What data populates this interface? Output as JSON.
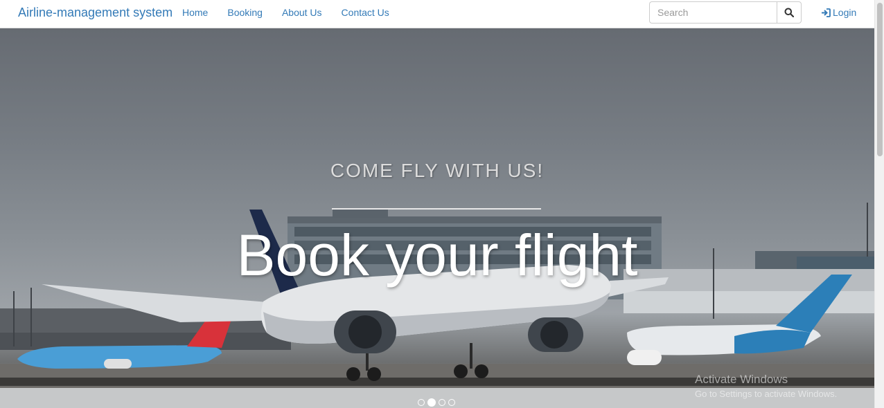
{
  "navbar": {
    "brand": "Airline-management system",
    "links": [
      "Home",
      "Booking",
      "About Us",
      "Contact Us"
    ],
    "search": {
      "placeholder": "Search",
      "value": ""
    },
    "login_label": "Login"
  },
  "hero": {
    "tagline": "COME FLY WITH US!",
    "headline": "Book your flight",
    "slide_count": 4,
    "active_slide": 2
  },
  "watermark": {
    "title": "Activate Windows",
    "subtitle": "Go to Settings to activate Windows."
  },
  "colors": {
    "link": "#337ab7",
    "sky": "#777d84"
  }
}
